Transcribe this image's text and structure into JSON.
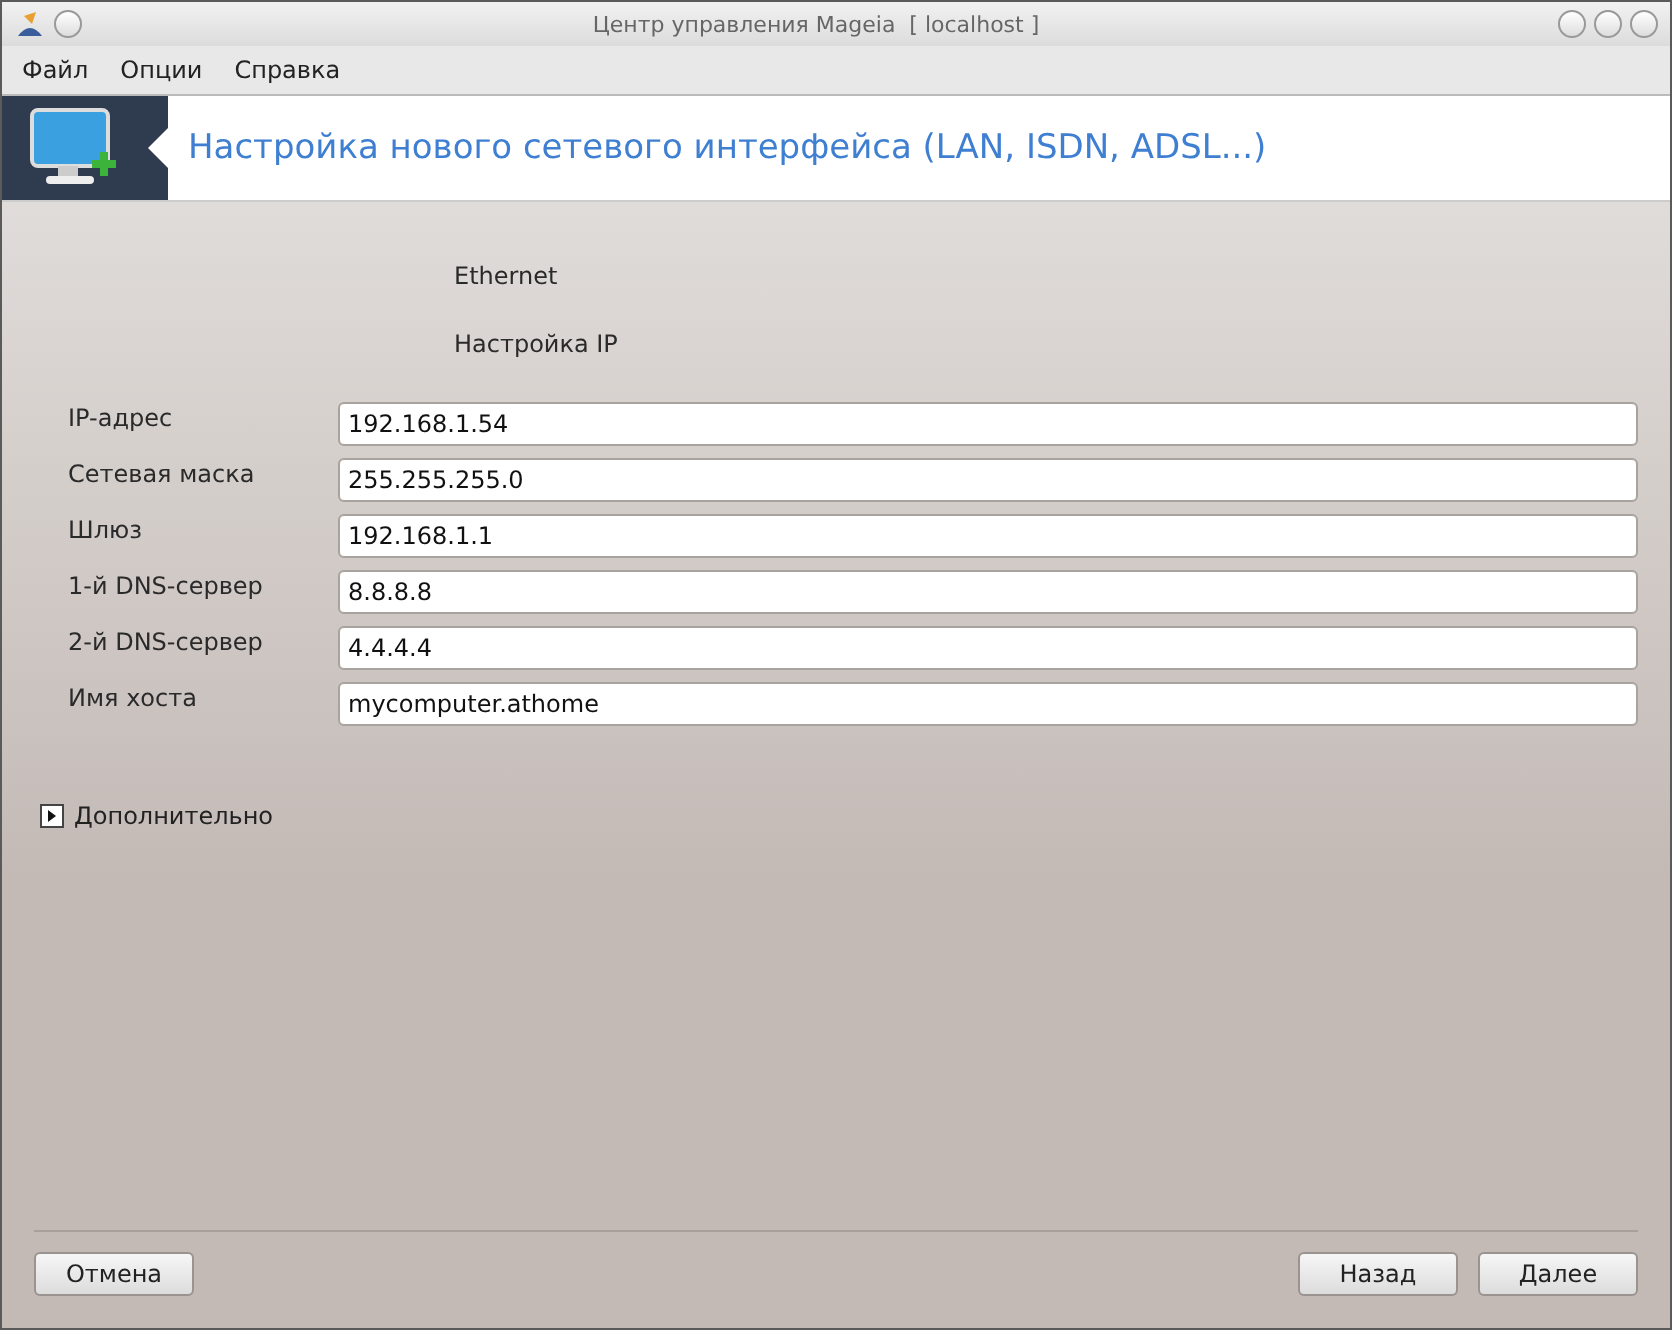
{
  "window": {
    "title": "Центр управления Mageia  [ localhost ]"
  },
  "menu": [
    "Файл",
    "Опции",
    "Справка"
  ],
  "banner": {
    "title": "Настройка нового сетевого интерфейса (LAN, ISDN, ADSL...)"
  },
  "headings": [
    "Ethernet",
    "Настройка IP"
  ],
  "fields": [
    {
      "label": "IP-адрес",
      "value": "192.168.1.54"
    },
    {
      "label": "Сетевая маска",
      "value": "255.255.255.0"
    },
    {
      "label": "Шлюз",
      "value": "192.168.1.1"
    },
    {
      "label": "1-й DNS-сервер",
      "value": "8.8.8.8"
    },
    {
      "label": "2-й DNS-сервер",
      "value": "4.4.4.4"
    },
    {
      "label": "Имя хоста",
      "value": "mycomputer.athome"
    }
  ],
  "expander": {
    "label": "Дополнительно",
    "expanded": false
  },
  "buttons": {
    "cancel": "Отмена",
    "back": "Назад",
    "next": "Далее"
  }
}
